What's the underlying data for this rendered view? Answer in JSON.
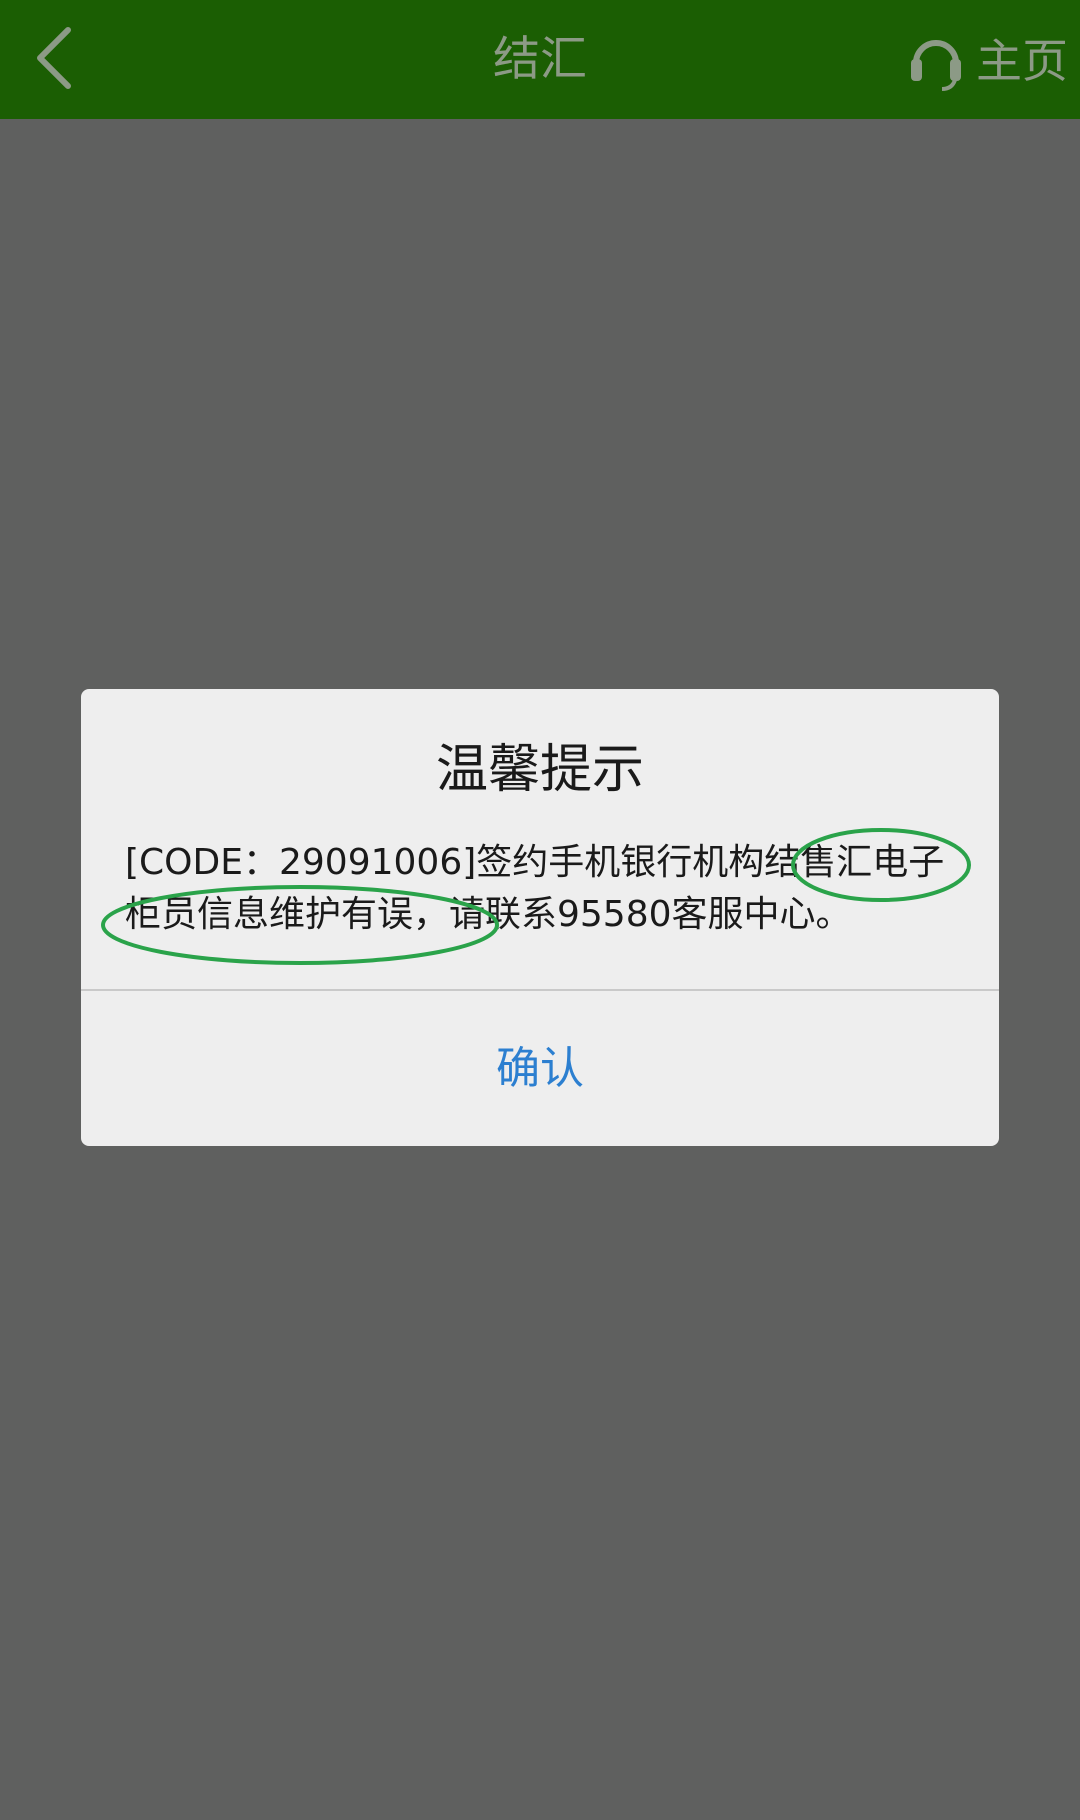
{
  "header": {
    "title": "结汇",
    "home_label": "主页",
    "back_icon": "chevron-left-icon",
    "service_icon": "headset-icon",
    "bg_color": "#1b5e03",
    "text_color": "#8c9a86"
  },
  "dialog": {
    "title": "温馨提示",
    "message": "[CODE：29091006]签约手机银行机构结售汇电子柜员信息维护有误，请联系95580客服中心。",
    "confirm_label": "确认",
    "confirm_color": "#2c7fd0"
  },
  "annotations": {
    "color": "#2aa34a"
  }
}
